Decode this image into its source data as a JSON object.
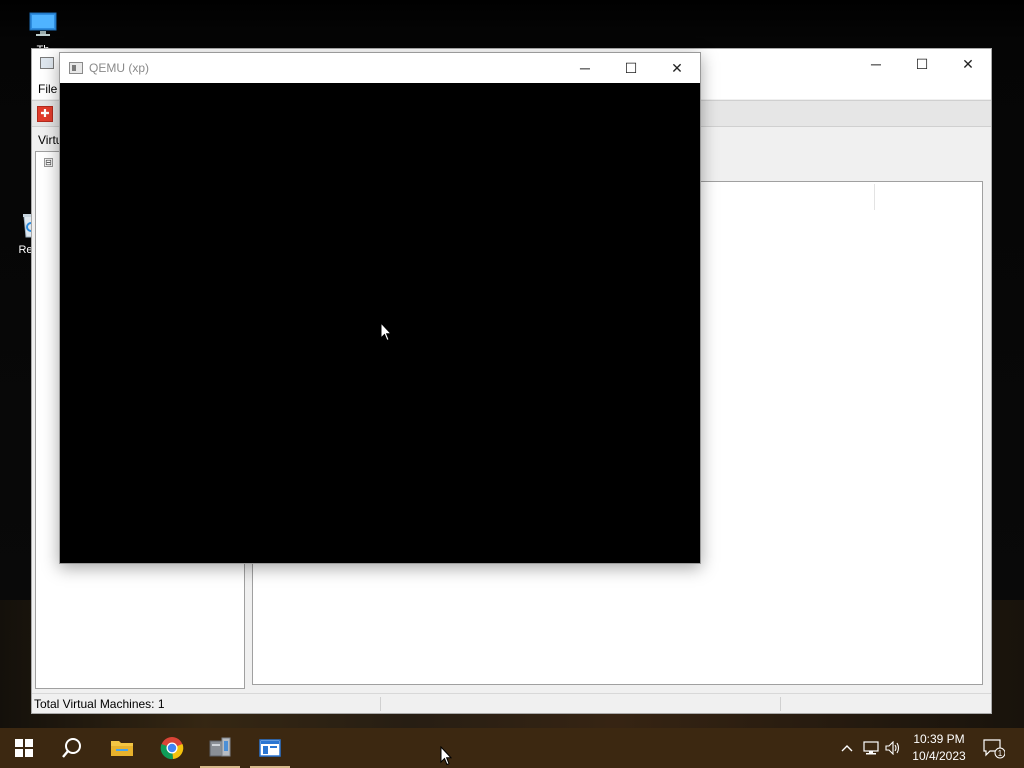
{
  "desktop": {
    "icons": [
      {
        "label": "Th",
        "icon": "this-pc-icon"
      },
      {
        "label": "Recy",
        "icon": "recycle-bin-icon"
      }
    ]
  },
  "manager_window": {
    "menu": {
      "file": "File"
    },
    "tabs": {
      "virtual": "Virtu"
    },
    "tree_toggle": "⊟",
    "status": "Total Virtual Machines: 1",
    "accent_color": "#e23c2c"
  },
  "qemu_window": {
    "title": "QEMU (xp)",
    "screen_color": "#000000"
  },
  "window_controls": {
    "minimize": "─",
    "maximize": "☐",
    "close": "✕"
  },
  "taskbar": {
    "color": "#3c2811",
    "apps": [
      {
        "name": "start",
        "icon": "windows-start-icon"
      },
      {
        "name": "search",
        "icon": "search-icon"
      },
      {
        "name": "file-explorer",
        "icon": "folder-icon"
      },
      {
        "name": "chrome",
        "icon": "chrome-icon"
      },
      {
        "name": "qemu-manager",
        "icon": "vm-manager-icon"
      },
      {
        "name": "qemu",
        "icon": "qemu-window-icon"
      }
    ],
    "tray": {
      "clock_time": "10:39 PM",
      "clock_date": "10/4/2023",
      "notification_count": "1"
    }
  }
}
